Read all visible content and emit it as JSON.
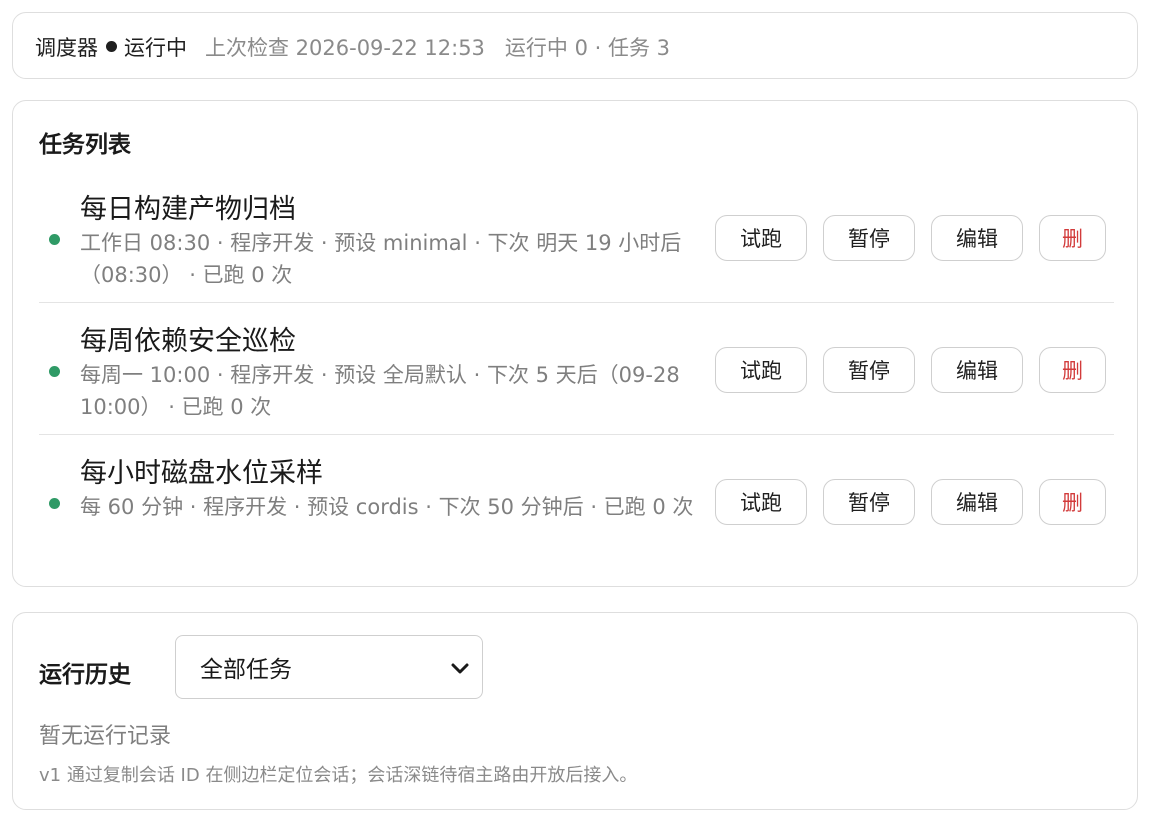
{
  "status": {
    "name": "调度器",
    "state": "运行中",
    "last_check": "上次检查 2026-09-22 12:53",
    "counts": "运行中 0 · 任务 3"
  },
  "tasks_section": {
    "title": "任务列表",
    "tasks": [
      {
        "title": "每日构建产物归档",
        "meta": "工作日 08:30 · 程序开发 · 预设 minimal · 下次 明天 19 小时后（08:30） · 已跑 0 次",
        "status_color": "#2f9a66"
      },
      {
        "title": "每周依赖安全巡检",
        "meta": "每周一 10:00 · 程序开发 · 预设 全局默认 · 下次 5 天后（09-28 10:00） · 已跑 0 次",
        "status_color": "#2f9a66"
      },
      {
        "title": "每小时磁盘水位采样",
        "meta": "每 60 分钟 · 程序开发 · 预设 cordis · 下次 50 分钟后 · 已跑 0 次",
        "status_color": "#2f9a66"
      }
    ],
    "actions": {
      "trial_label": "试跑",
      "pause_label": "暂停",
      "edit_label": "编辑",
      "delete_label": "删"
    }
  },
  "history": {
    "title": "运行历史",
    "filter_selected": "全部任务",
    "empty_text": "暂无运行记录",
    "note": "v1 通过复制会话 ID 在侧边栏定位会话；会话深链待宿主路由开放后接入。"
  },
  "colors": {
    "status_green": "#2f9a66",
    "danger_red": "#d23b3b",
    "muted_text": "#7f7f7f",
    "border": "#dedede"
  },
  "icons": {
    "status_dot": "bullet-icon",
    "select_chevron": "chevron-down-icon"
  }
}
